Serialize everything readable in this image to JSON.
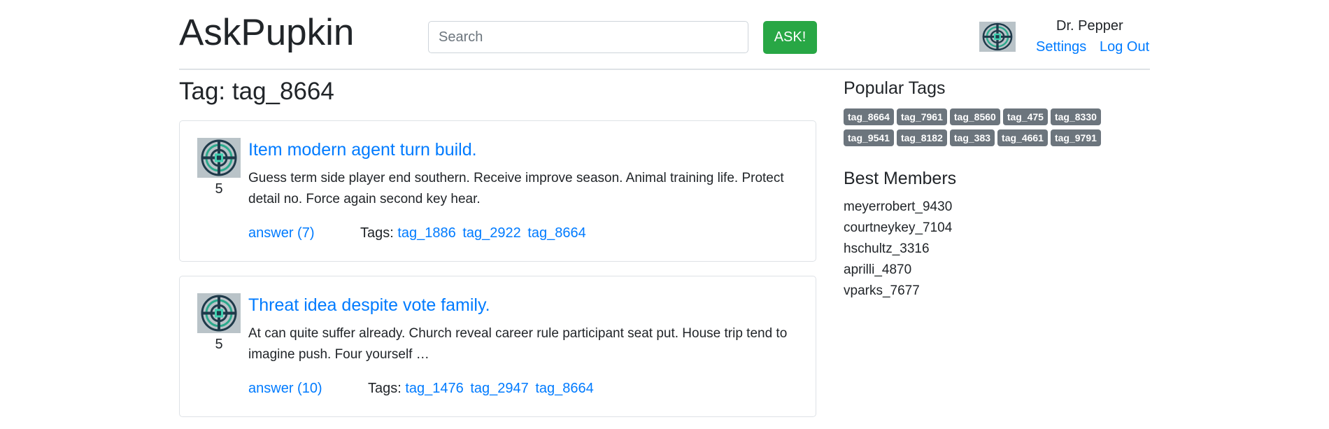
{
  "header": {
    "logo": "AskPupkin",
    "search_placeholder": "Search",
    "ask_label": "ASK!",
    "user_name": "Dr. Pepper",
    "settings_label": "Settings",
    "logout_label": "Log Out"
  },
  "main": {
    "page_title": "Tag: tag_8664",
    "questions": [
      {
        "rating": "5",
        "title": "Item modern agent turn build.",
        "text": "Guess term side player end southern. Receive improve season. Animal training life. Protect detail no. Force again second key hear.",
        "answer_label": "answer (7)",
        "tags_label": "Tags:",
        "tags": [
          "tag_1886",
          "tag_2922",
          "tag_8664"
        ]
      },
      {
        "rating": "5",
        "title": "Threat idea despite vote family.",
        "text": "At can quite suffer already. Church reveal career rule participant seat put. House trip tend to imagine push. Four yourself …",
        "answer_label": "answer (10)",
        "tags_label": "Tags:",
        "tags": [
          "tag_1476",
          "tag_2947",
          "tag_8664"
        ]
      }
    ]
  },
  "sidebar": {
    "popular_tags_title": "Popular Tags",
    "popular_tags": [
      "tag_8664",
      "tag_7961",
      "tag_8560",
      "tag_475",
      "tag_8330",
      "tag_9541",
      "tag_8182",
      "tag_383",
      "tag_4661",
      "tag_9791"
    ],
    "best_members_title": "Best Members",
    "best_members": [
      "meyerrobert_9430",
      "courtneykey_7104",
      "hschultz_3316",
      "aprilli_4870",
      "vparks_7677"
    ]
  },
  "colors": {
    "link": "#007bff",
    "ask_button": "#28a745",
    "badge": "#6c757d"
  }
}
